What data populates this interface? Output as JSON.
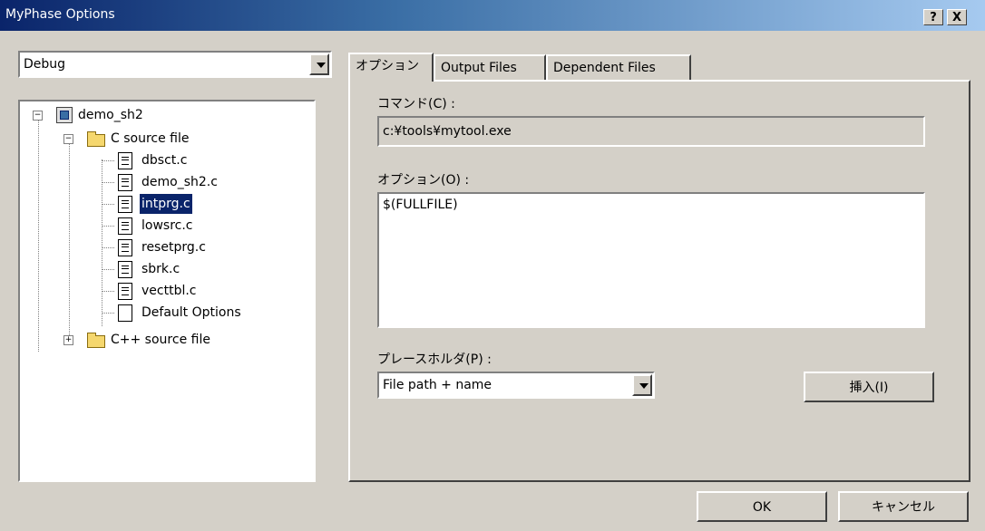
{
  "window": {
    "title": "MyPhase Options",
    "help_button": "?",
    "close_button": "X"
  },
  "config_select": {
    "value": "Debug"
  },
  "tree": {
    "project": "demo_sh2",
    "c_folder": "C source file",
    "files": [
      "dbsct.c",
      "demo_sh2.c",
      "intprg.c",
      "lowsrc.c",
      "resetprg.c",
      "sbrk.c",
      "vecttbl.c"
    ],
    "default_options": "Default Options",
    "cpp_folder": "C++ source file",
    "selected": "intprg.c"
  },
  "tabs": [
    "オプション",
    "Output Files",
    "Dependent Files"
  ],
  "options": {
    "command_label": "コマンド(C) :",
    "command_value": "c:¥tools¥mytool.exe",
    "options_label": "オプション(O) :",
    "options_value": "$(FULLFILE)",
    "placeholder_label": "プレースホルダ(P) :",
    "placeholder_value": "File path + name",
    "insert_button": "挿入(I)"
  },
  "footer": {
    "ok_button": "OK",
    "cancel_button": "キャンセル"
  }
}
